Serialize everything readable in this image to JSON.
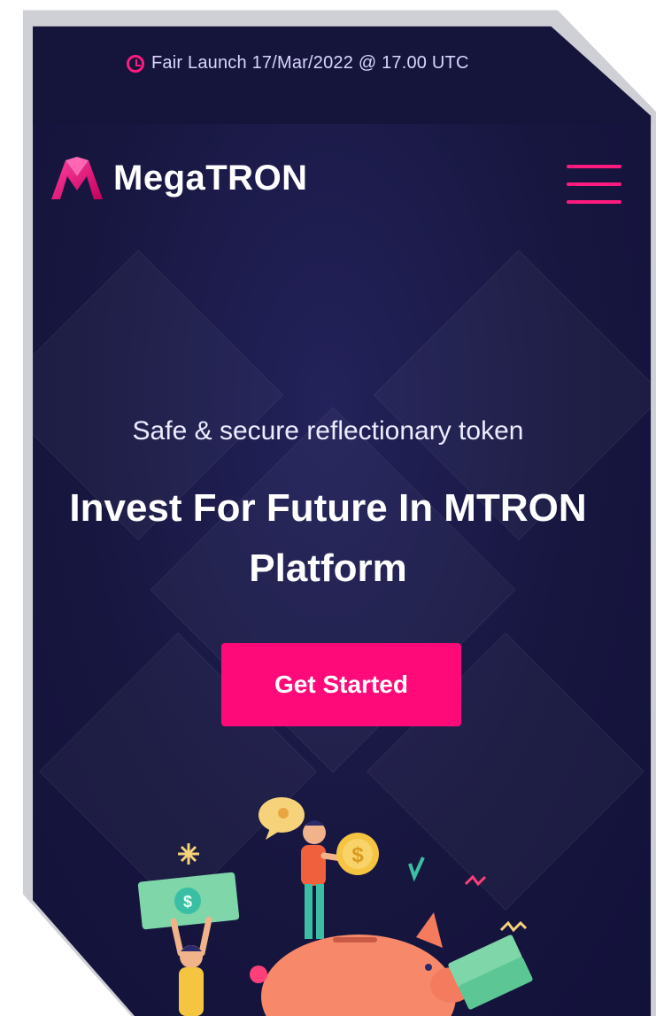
{
  "announcement": {
    "icon": "clock-icon",
    "text": "Fair Launch 17/Mar/2022 @ 17.00 UTC"
  },
  "brand": {
    "name": "MegaTRON",
    "logo_icon": "megatron-logo-icon"
  },
  "menu": {
    "icon": "hamburger-menu-icon"
  },
  "hero": {
    "tagline": "Safe & secure reflectionary token",
    "headline": "Invest For Future In MTRON Platform",
    "cta_label": "Get Started"
  },
  "colors": {
    "accent": "#ff0a78",
    "background": "#17163f",
    "text": "#ffffff"
  }
}
